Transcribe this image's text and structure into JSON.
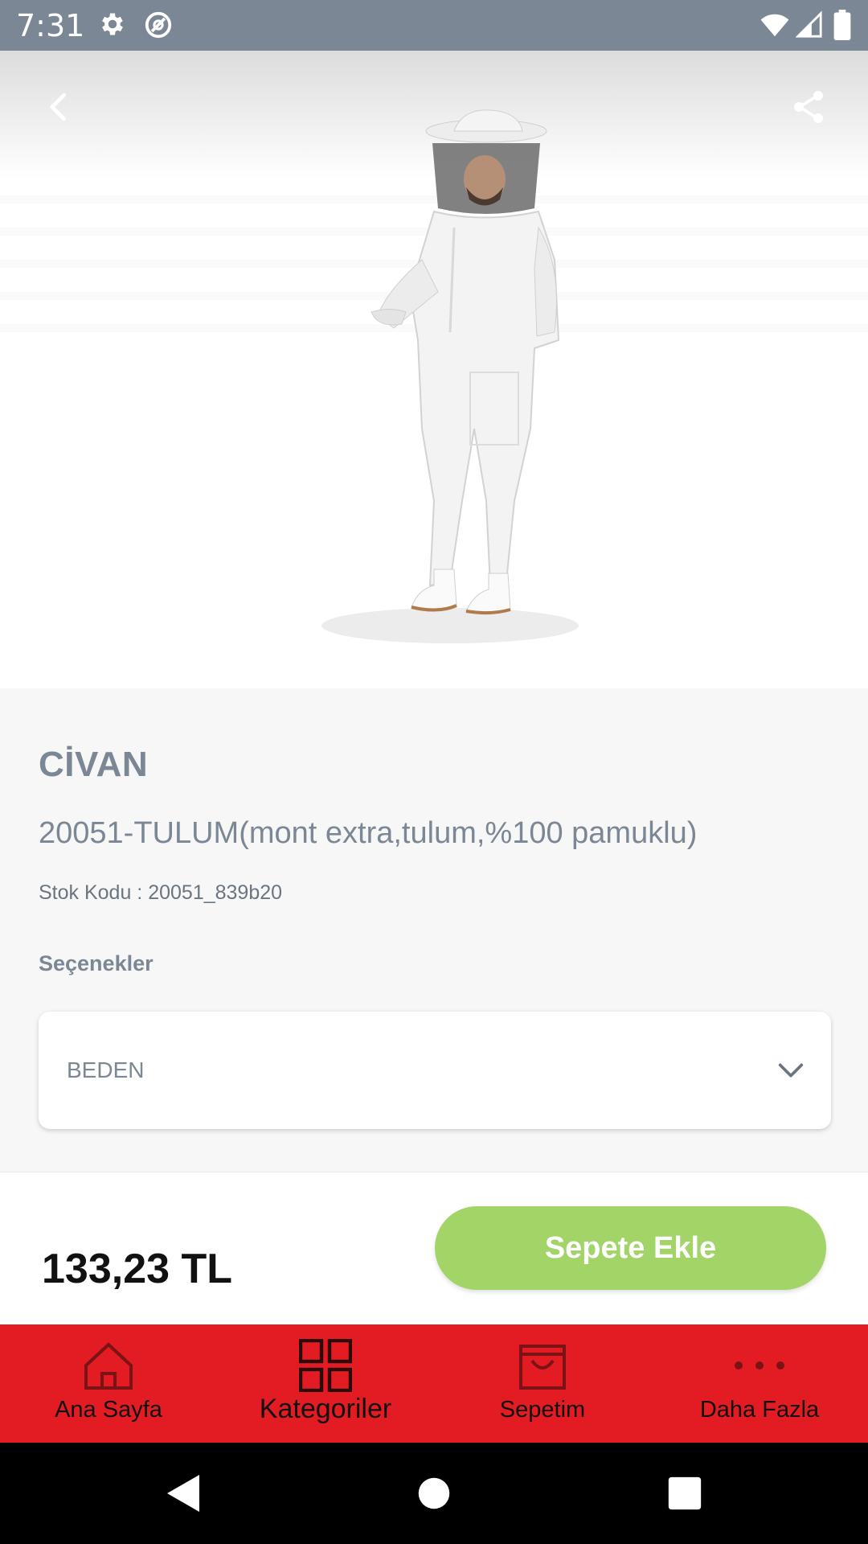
{
  "status_bar": {
    "time": "7:31",
    "icons": [
      "gear-icon",
      "sync-icon",
      "wifi-icon",
      "signal-icon",
      "battery-icon"
    ]
  },
  "toolbar": {
    "back_icon": "chevron-left-icon",
    "share_icon": "share-icon"
  },
  "product": {
    "image": "Beekeeper in white protective suit and veiled hat",
    "brand": "CİVAN",
    "title": "20051-TULUM(mont extra,tulum,%100 pamuklu)",
    "sku_label": "Stok Kodu :",
    "sku_value": "20051_839b20",
    "options_label": "Seçenekler",
    "option_select": {
      "value": "BEDEN",
      "icon": "chevron-down-icon"
    }
  },
  "purchase": {
    "price": "133,23 TL",
    "add_to_cart_label": "Sepete Ekle",
    "button_color": "#a3d468"
  },
  "bottom_nav": {
    "color": "#e31b23",
    "items": [
      {
        "label": "Ana Sayfa",
        "icon": "home-icon"
      },
      {
        "label": "Kategoriler",
        "icon": "grid-icon"
      },
      {
        "label": "Sepetim",
        "icon": "shopping-bag-icon"
      },
      {
        "label": "Daha Fazla",
        "icon": "more-icon"
      }
    ]
  },
  "system_nav": {
    "icons": [
      "back-triangle-icon",
      "home-circle-icon",
      "recents-square-icon"
    ]
  }
}
